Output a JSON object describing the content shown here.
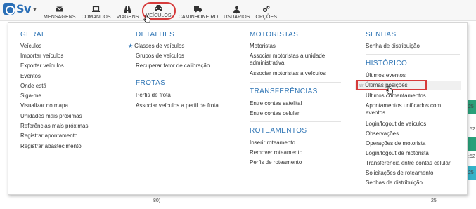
{
  "logo": {
    "text": "Sv"
  },
  "nav": [
    {
      "name": "mensagens",
      "label": "MENSAGENS",
      "icon": "envelope-icon"
    },
    {
      "name": "comandos",
      "label": "COMANDOS",
      "icon": "laptop-icon"
    },
    {
      "name": "viagens",
      "label": "VIAGENS",
      "icon": "road-icon"
    },
    {
      "name": "veiculos",
      "label": "VEÍCULOS",
      "icon": "car-icon"
    },
    {
      "name": "caminhoneiro",
      "label": "CAMINHONEIRO",
      "icon": "truck-icon"
    },
    {
      "name": "usuarios",
      "label": "USUÁRIOS",
      "icon": "user-icon"
    },
    {
      "name": "opcoes",
      "label": "OPÇÕES",
      "icon": "gears-icon"
    }
  ],
  "menu": {
    "geral": {
      "title": "GERAL",
      "items": [
        "Veículos",
        "Importar veículos",
        "Exportar veículos",
        "Eventos",
        "Onde está",
        "Siga-me",
        "Visualizar no mapa",
        "Unidades mais próximas",
        "Referências mais próximas",
        "Registrar apontamento",
        "Registrar abastecimento"
      ]
    },
    "detalhes": {
      "title": "DETALHES",
      "items": [
        "Classes de veículos",
        "Grupos de veículos",
        "Recuperar fator de calibração"
      ]
    },
    "frotas": {
      "title": "FROTAS",
      "items": [
        "Perfis de frota",
        "Associar veículos a perfil de frota"
      ]
    },
    "motoristas": {
      "title": "MOTORISTAS",
      "items": [
        "Motoristas",
        "Associar motoristas a unidade administrativa",
        "Associar motoristas a veículos"
      ]
    },
    "transferencias": {
      "title": "TRANSFERÊNCIAS",
      "items": [
        "Entre contas satelital",
        "Entre contas celular"
      ]
    },
    "roteamentos": {
      "title": "ROTEAMENTOS",
      "items": [
        "Inserir roteamento",
        "Remover roteamento",
        "Perfis de roteamento"
      ]
    },
    "senhas": {
      "title": "SENHAS",
      "items": [
        "Senha de distribuição"
      ]
    },
    "historico": {
      "title": "HISTÓRICO",
      "items": [
        "Últimos eventos",
        "Últimas posições",
        "Últimos comentamentos",
        "Apontamentos unificados com eventos",
        "Login/logout de veículos",
        "Observações",
        "Operações de motorista",
        "Login/logout de motorista",
        "Transferência entre contas celular",
        "Solicitações de roteamento",
        "Senhas de distribuição"
      ]
    }
  },
  "background": {
    "cells": [
      "25",
      ":52",
      ":52",
      "25",
      "80)",
      "25"
    ],
    "strip_colors": [
      "#2aa07a",
      "#2aa07a",
      "#34b3c9"
    ]
  },
  "colors": {
    "accent": "#2f75b5",
    "highlight": "#d63b3b"
  }
}
